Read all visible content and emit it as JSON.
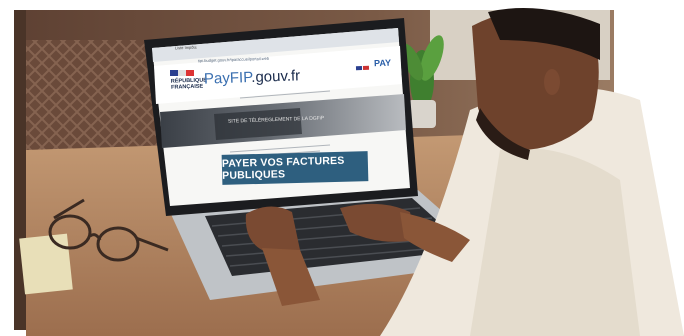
{
  "screen": {
    "tab_label": "Liste Impôts",
    "url": "tipi.budget.gouv.fr/tpa/accueilportail.web",
    "republic_lines": "RÉPUBLIQUE FRANÇAISE",
    "logo_brand": "PayFIP",
    "logo_domain": ".gouv.fr",
    "banner_title": "SITE DE TÉLÉREGLEMENT DE LA DGFiP",
    "cta_label": "PAYER VOS FACTURES PUBLIQUES",
    "pay_badge": "PAY"
  },
  "colors": {
    "cta_bg": "#2e5f7f",
    "wall": "#6b4b3a",
    "desk": "#b98a66",
    "shirt": "#efe8dd",
    "skin": "#7a4a32"
  }
}
